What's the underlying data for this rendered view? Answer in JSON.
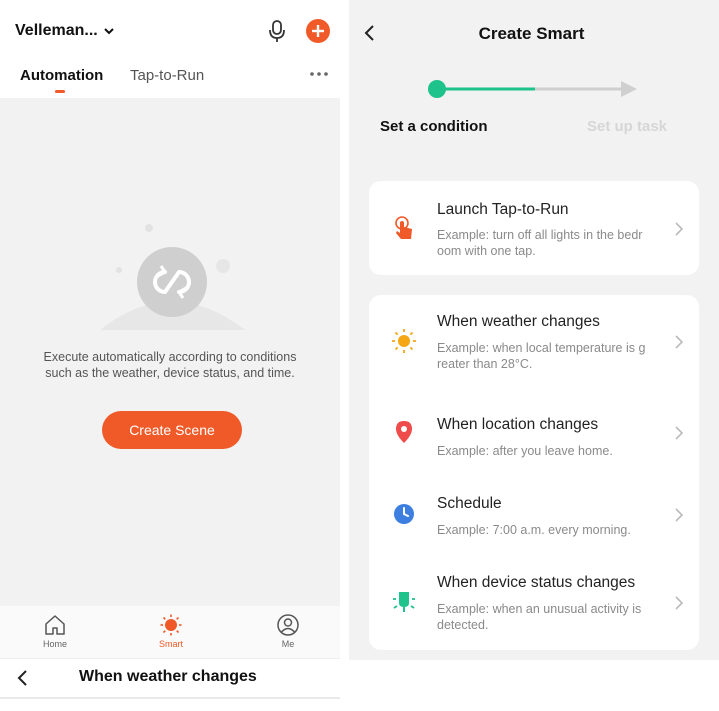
{
  "left_screen": {
    "home_name": "Velleman...",
    "tabs": [
      {
        "label": "Automation",
        "active": true
      },
      {
        "label": "Tap-to-Run",
        "active": false
      }
    ],
    "empty_state": {
      "description_line1": "Execute automatically according to conditions",
      "description_line2": "such as the weather, device status, and time.",
      "create_button": "Create Scene"
    },
    "bottom_nav": [
      {
        "label": "Home",
        "icon": "home-icon",
        "active": false
      },
      {
        "label": "Smart",
        "icon": "sun-icon",
        "active": true
      },
      {
        "label": "Me",
        "icon": "profile-icon",
        "active": false
      }
    ],
    "next_screen_title": "When weather changes"
  },
  "right_screen": {
    "title": "Create Smart",
    "steps": [
      {
        "label": "Set a condition",
        "active": true
      },
      {
        "label": "Set up task",
        "active": false
      }
    ],
    "conditions": [
      {
        "title": "Launch Tap-to-Run",
        "line1": "Example: turn off all lights in the bedr",
        "line2": "oom with one tap.",
        "icon": "tap-hand-icon"
      },
      {
        "title": "When weather changes",
        "line1": "Example: when local temperature is g",
        "line2": "reater than 28°C.",
        "icon": "sun-icon"
      },
      {
        "title": "When location changes",
        "line1": "Example: after you leave home.",
        "line2": "",
        "icon": "location-pin-icon"
      },
      {
        "title": "Schedule",
        "line1": "Example: 7:00 a.m. every morning.",
        "line2": "",
        "icon": "clock-icon"
      },
      {
        "title": "When device status changes",
        "line1": "Example: when an unusual activity is",
        "line2": "detected.",
        "icon": "device-icon"
      }
    ]
  },
  "colors": {
    "accent": "#f05a28",
    "step_active": "#1ec28b",
    "background": "#f2f2f2"
  }
}
